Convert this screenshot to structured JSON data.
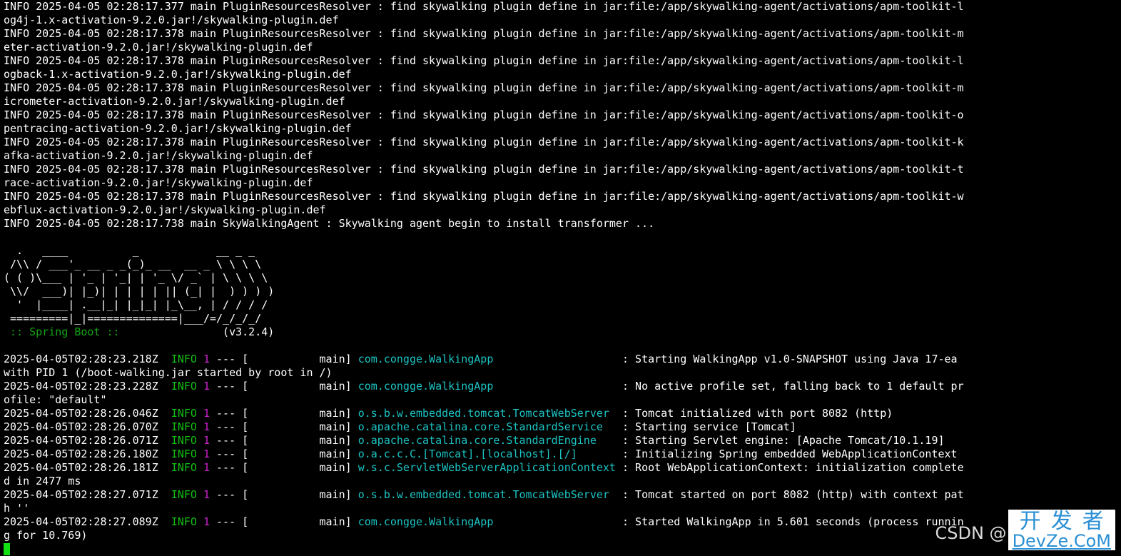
{
  "terminal": {
    "segments": [
      [
        {
          "t": "INFO 2025-04-05 02:28:17.377 main PluginResourcesResolver : find skywalking plugin define in jar:file:/app/skywalking-agent/activations/apm-toolkit-l"
        }
      ],
      [
        {
          "t": "og4j-1.x-activation-9.2.0.jar!/skywalking-plugin.def"
        }
      ],
      [
        {
          "t": "INFO 2025-04-05 02:28:17.378 main PluginResourcesResolver : find skywalking plugin define in jar:file:/app/skywalking-agent/activations/apm-toolkit-m"
        }
      ],
      [
        {
          "t": "eter-activation-9.2.0.jar!/skywalking-plugin.def"
        }
      ],
      [
        {
          "t": "INFO 2025-04-05 02:28:17.378 main PluginResourcesResolver : find skywalking plugin define in jar:file:/app/skywalking-agent/activations/apm-toolkit-l"
        }
      ],
      [
        {
          "t": "ogback-1.x-activation-9.2.0.jar!/skywalking-plugin.def"
        }
      ],
      [
        {
          "t": "INFO 2025-04-05 02:28:17.378 main PluginResourcesResolver : find skywalking plugin define in jar:file:/app/skywalking-agent/activations/apm-toolkit-m"
        }
      ],
      [
        {
          "t": "icrometer-activation-9.2.0.jar!/skywalking-plugin.def"
        }
      ],
      [
        {
          "t": "INFO 2025-04-05 02:28:17.378 main PluginResourcesResolver : find skywalking plugin define in jar:file:/app/skywalking-agent/activations/apm-toolkit-o"
        }
      ],
      [
        {
          "t": "pentracing-activation-9.2.0.jar!/skywalking-plugin.def"
        }
      ],
      [
        {
          "t": "INFO 2025-04-05 02:28:17.378 main PluginResourcesResolver : find skywalking plugin define in jar:file:/app/skywalking-agent/activations/apm-toolkit-k"
        }
      ],
      [
        {
          "t": "afka-activation-9.2.0.jar!/skywalking-plugin.def"
        }
      ],
      [
        {
          "t": "INFO 2025-04-05 02:28:17.378 main PluginResourcesResolver : find skywalking plugin define in jar:file:/app/skywalking-agent/activations/apm-toolkit-t"
        }
      ],
      [
        {
          "t": "race-activation-9.2.0.jar!/skywalking-plugin.def"
        }
      ],
      [
        {
          "t": "INFO 2025-04-05 02:28:17.378 main PluginResourcesResolver : find skywalking plugin define in jar:file:/app/skywalking-agent/activations/apm-toolkit-w"
        }
      ],
      [
        {
          "t": "ebflux-activation-9.2.0.jar!/skywalking-plugin.def"
        }
      ],
      [
        {
          "t": "INFO 2025-04-05 02:28:17.738 main SkyWalkingAgent : Skywalking agent begin to install transformer ..."
        }
      ],
      [
        {
          "t": ""
        }
      ],
      [
        {
          "t": "  .   ____          _            __ _ _"
        }
      ],
      [
        {
          "t": " /\\\\ / ___'_ __ _ _(_)_ __  __ _ \\ \\ \\ \\"
        }
      ],
      [
        {
          "t": "( ( )\\___ | '_ | '_| | '_ \\/ _` | \\ \\ \\ \\"
        }
      ],
      [
        {
          "t": " \\\\/  ___)| |_)| | | | | || (_| |  ) ) ) )"
        }
      ],
      [
        {
          "t": "  '  |____| .__|_| |_|_| |_\\__, | / / / /"
        }
      ],
      [
        {
          "t": " =========|_|==============|___/=/_/_/_/"
        }
      ],
      [
        {
          "t": " :: Spring Boot :: ",
          "c": "spring"
        },
        {
          "t": "               (v3.2.4)"
        }
      ],
      [
        {
          "t": ""
        }
      ],
      [
        {
          "t": "2025-04-05T02:28:23.218Z  "
        },
        {
          "t": "INFO",
          "c": "info"
        },
        {
          "t": " "
        },
        {
          "t": "1",
          "c": "pid"
        },
        {
          "t": " --- [           main] "
        },
        {
          "t": "com.congge.WalkingApp                   ",
          "c": "cls"
        },
        {
          "t": " : Starting WalkingApp v1.0-SNAPSHOT using Java 17-ea"
        }
      ],
      [
        {
          "t": "with PID 1 (/boot-walking.jar started by root in /)"
        }
      ],
      [
        {
          "t": "2025-04-05T02:28:23.228Z  "
        },
        {
          "t": "INFO",
          "c": "info"
        },
        {
          "t": " "
        },
        {
          "t": "1",
          "c": "pid"
        },
        {
          "t": " --- [           main] "
        },
        {
          "t": "com.congge.WalkingApp                   ",
          "c": "cls"
        },
        {
          "t": " : No active profile set, falling back to 1 default pr"
        }
      ],
      [
        {
          "t": "ofile: \"default\""
        }
      ],
      [
        {
          "t": "2025-04-05T02:28:26.046Z  "
        },
        {
          "t": "INFO",
          "c": "info"
        },
        {
          "t": " "
        },
        {
          "t": "1",
          "c": "pid"
        },
        {
          "t": " --- [           main] "
        },
        {
          "t": "o.s.b.w.embedded.tomcat.TomcatWebServer ",
          "c": "cls"
        },
        {
          "t": " : Tomcat initialized with port 8082 (http)"
        }
      ],
      [
        {
          "t": "2025-04-05T02:28:26.070Z  "
        },
        {
          "t": "INFO",
          "c": "info"
        },
        {
          "t": " "
        },
        {
          "t": "1",
          "c": "pid"
        },
        {
          "t": " --- [           main] "
        },
        {
          "t": "o.apache.catalina.core.StandardService  ",
          "c": "cls"
        },
        {
          "t": " : Starting service [Tomcat]"
        }
      ],
      [
        {
          "t": "2025-04-05T02:28:26.071Z  "
        },
        {
          "t": "INFO",
          "c": "info"
        },
        {
          "t": " "
        },
        {
          "t": "1",
          "c": "pid"
        },
        {
          "t": " --- [           main] "
        },
        {
          "t": "o.apache.catalina.core.StandardEngine   ",
          "c": "cls"
        },
        {
          "t": " : Starting Servlet engine: [Apache Tomcat/10.1.19]"
        }
      ],
      [
        {
          "t": "2025-04-05T02:28:26.180Z  "
        },
        {
          "t": "INFO",
          "c": "info"
        },
        {
          "t": " "
        },
        {
          "t": "1",
          "c": "pid"
        },
        {
          "t": " --- [           main] "
        },
        {
          "t": "o.a.c.c.C.[Tomcat].[localhost].[/]      ",
          "c": "cls"
        },
        {
          "t": " : Initializing Spring embedded WebApplicationContext"
        }
      ],
      [
        {
          "t": "2025-04-05T02:28:26.181Z  "
        },
        {
          "t": "INFO",
          "c": "info"
        },
        {
          "t": " "
        },
        {
          "t": "1",
          "c": "pid"
        },
        {
          "t": " --- [           main] "
        },
        {
          "t": "w.s.c.ServletWebServerApplicationContext",
          "c": "cls"
        },
        {
          "t": " : Root WebApplicationContext: initialization complete"
        }
      ],
      [
        {
          "t": "d in 2477 ms"
        }
      ],
      [
        {
          "t": "2025-04-05T02:28:27.071Z  "
        },
        {
          "t": "INFO",
          "c": "info"
        },
        {
          "t": " "
        },
        {
          "t": "1",
          "c": "pid"
        },
        {
          "t": " --- [           main] "
        },
        {
          "t": "o.s.b.w.embedded.tomcat.TomcatWebServer ",
          "c": "cls"
        },
        {
          "t": " : Tomcat started on port 8082 (http) with context pat"
        }
      ],
      [
        {
          "t": "h ''"
        }
      ],
      [
        {
          "t": "2025-04-05T02:28:27.089Z  "
        },
        {
          "t": "INFO",
          "c": "info"
        },
        {
          "t": " "
        },
        {
          "t": "1",
          "c": "pid"
        },
        {
          "t": " --- [           main] "
        },
        {
          "t": "com.congge.WalkingApp                   ",
          "c": "cls"
        },
        {
          "t": " : Started WalkingApp in 5.601 seconds (process runnin"
        }
      ],
      [
        {
          "t": "g for 10.769)"
        }
      ]
    ]
  },
  "colors": {
    "background": "#000000",
    "text": "#ffffff",
    "info_level": "#13c013",
    "pid": "#cc22cc",
    "logger_class": "#1cc3c3",
    "spring_banner": "#13a513",
    "cursor": "#13e013"
  },
  "watermark": {
    "csdn": "CSDN @",
    "cn": "开发者",
    "en": "DevZe.CoM"
  }
}
